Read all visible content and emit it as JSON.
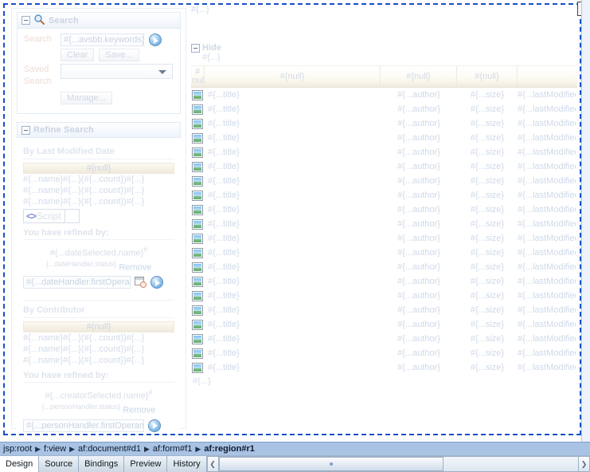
{
  "window": {
    "selected_component": "af:region#r1"
  },
  "search_panel": {
    "title": "Search",
    "icon": "magnifier-icon",
    "search_label": "Search",
    "keywords_value": "#{...avsbb.keywords}",
    "clear_label": "Clear",
    "save_label": "Save...",
    "saved_search_label_line1": "Saved",
    "saved_search_label_line2": "Search",
    "saved_search_value": "",
    "manage_label": "Manage..."
  },
  "refine_panel": {
    "title": "Refine Search",
    "date_section": {
      "heading": "By Last Modified Date",
      "facet_bar": "#{null}",
      "facets": [
        "#{...name}#{...}(#{...count})#{...}",
        "#{...name}#{...}(#{...count})#{...}",
        "#{...name}#{...}(#{...count})#{...}"
      ],
      "script_chip_label": "Script",
      "script_chip_icon": "code-brackets-icon",
      "refined_heading": "You have refined by:",
      "refined_value": "#{...dateSelected.name}",
      "refined_value_sup": "#{...dateHandler.status}",
      "remove_label": "Remove",
      "operand_value": "#{...dateHandler.firstOperand}",
      "calendar_icon": "calendar-clock-icon",
      "go_icon": "go-arrow-icon"
    },
    "contributor_section": {
      "heading": "By Contributor",
      "facet_bar": "#{null}",
      "facets": [
        "#{...name}#{...}(#{...count})#{...}",
        "#{...name}#{...}(#{...count})#{...}",
        "#{...name}#{...}(#{...count})#{...}"
      ],
      "refined_heading": "You have refined by:",
      "refined_value": "#{...creatorSelected.name}",
      "refined_value_sup": "#{...personHandler.status}",
      "remove_label": "Remove",
      "operand_value": "#{...personHandler.firstOperand}",
      "go_icon": "go-arrow-icon"
    }
  },
  "results_region": {
    "top_ref": "#{...}",
    "hide_label": "Hide",
    "hide_sub_ref": "#{...}",
    "footer_ref": "#{...}",
    "table": {
      "columns": [
        {
          "line1": "#",
          "line2": "{null"
        },
        {
          "line1": "#{null}"
        },
        {
          "line1": "#{null}"
        },
        {
          "line1": "#{null}"
        },
        {
          "line1": ""
        }
      ],
      "row_template": {
        "icon": "thumbnail-icon",
        "title": "#{...title}",
        "author": "#{...author}",
        "size": "#{...size}",
        "last_modified": "#{...lastModified}"
      },
      "row_count": 20
    }
  },
  "breadcrumb": {
    "separator": "▶",
    "items": [
      {
        "label": "jsp:root",
        "active": false
      },
      {
        "label": "f:view",
        "active": false
      },
      {
        "label": "af:document#d1",
        "active": false
      },
      {
        "label": "af:form#f1",
        "active": false
      },
      {
        "label": "af:region#r1",
        "active": true
      }
    ]
  },
  "editor_tabs": {
    "items": [
      {
        "label": "Design",
        "active": true
      },
      {
        "label": "Source",
        "active": false
      },
      {
        "label": "Bindings",
        "active": false
      },
      {
        "label": "Preview",
        "active": false
      },
      {
        "label": "History",
        "active": false
      }
    ],
    "scroll_left_glyph": "❮",
    "scroll_right_glyph": "❯"
  }
}
